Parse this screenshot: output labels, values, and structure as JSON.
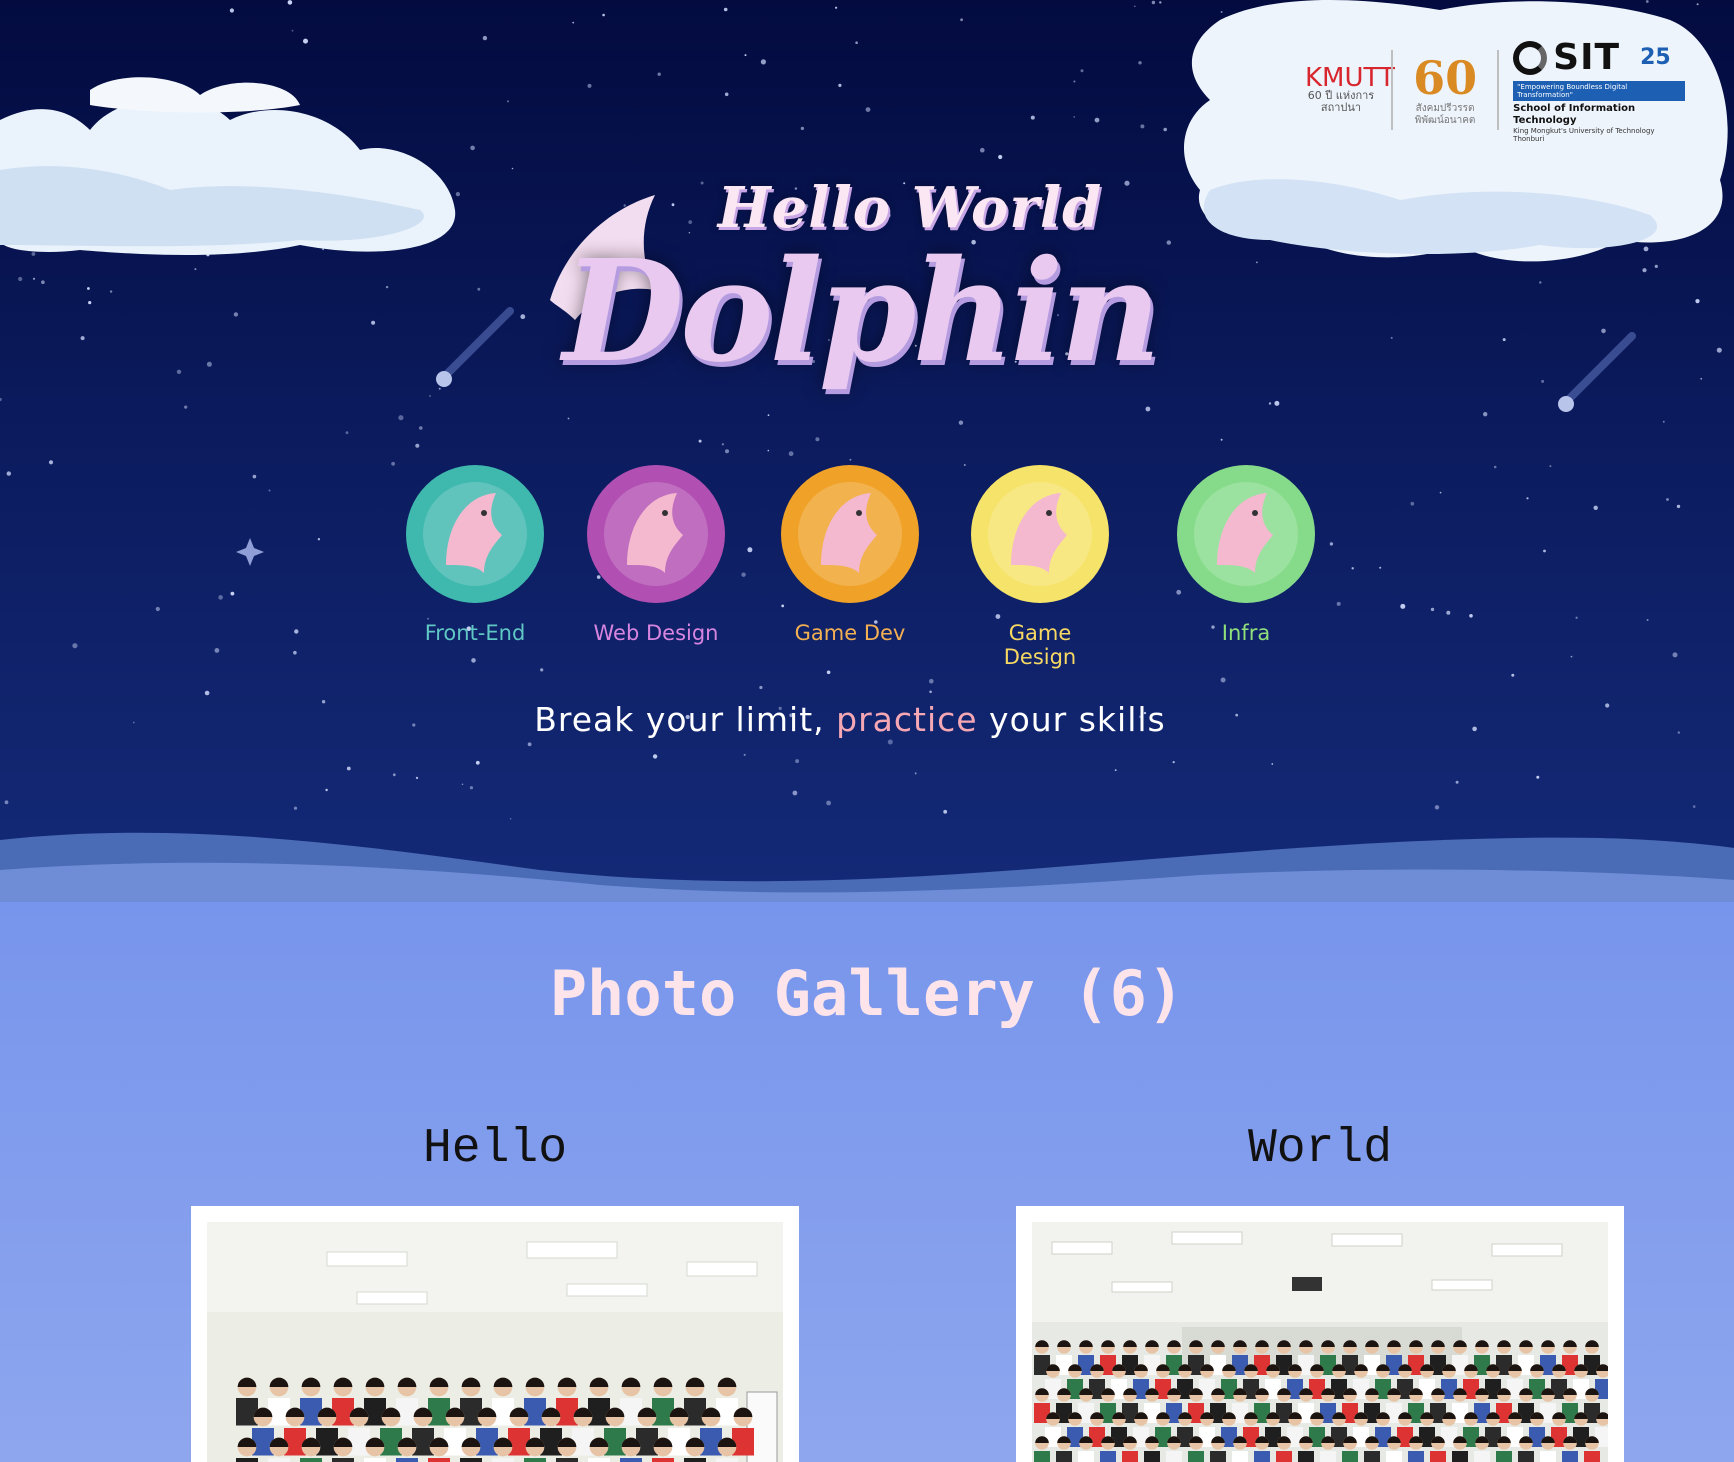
{
  "logos": {
    "kmutt": {
      "name": "KMUTT",
      "caption": "60 ปี แห่งการสถาปนา"
    },
    "sixty": {
      "name": "60",
      "caption": "สังคมปรีวรรตพิพัฒน์อนาคต"
    },
    "sit": {
      "name": "SIT",
      "years": "25",
      "tagline": "\"Empowering Boundless Digital Transformation\"",
      "school": "School of Information Technology",
      "university": "King Mongkut's University of Technology Thonburi"
    }
  },
  "hero": {
    "title_line1": "Hello World",
    "title_line2": "Dolphin",
    "slogan_pre": "Break your limit, ",
    "slogan_highlight": "practice",
    "slogan_post": " your skills"
  },
  "tracks": [
    {
      "label": "Front-End",
      "color": "#3fb8ae",
      "label_color": "#5fc7c4",
      "icon": "dolphin-js-php-react-icon"
    },
    {
      "label": "Web Design",
      "color": "#b24fb2",
      "label_color": "#d885e0",
      "icon": "dolphin-laptop-icon"
    },
    {
      "label": "Game Dev",
      "color": "#f0a228",
      "label_color": "#f3b052",
      "icon": "dolphin-binary-gamepad-icon"
    },
    {
      "label": "Game Design",
      "color": "#f6e36a",
      "label_color": "#f6d862",
      "icon": "dolphin-sliders-icon"
    },
    {
      "label": "Infra",
      "color": "#86db8a",
      "label_color": "#8fe07a",
      "icon": "dolphin-database-icon"
    }
  ],
  "gallery": {
    "title": "Photo Gallery (6)",
    "items": [
      {
        "caption": "Hello"
      },
      {
        "caption": "World"
      }
    ]
  },
  "colors": {
    "hero_bg_top": "#030b3f",
    "hero_bg_bottom": "#142a78",
    "gallery_bg": "#7d97ec",
    "gallery_title": "#fde4ea",
    "slogan_highlight": "#f5a7b4"
  }
}
